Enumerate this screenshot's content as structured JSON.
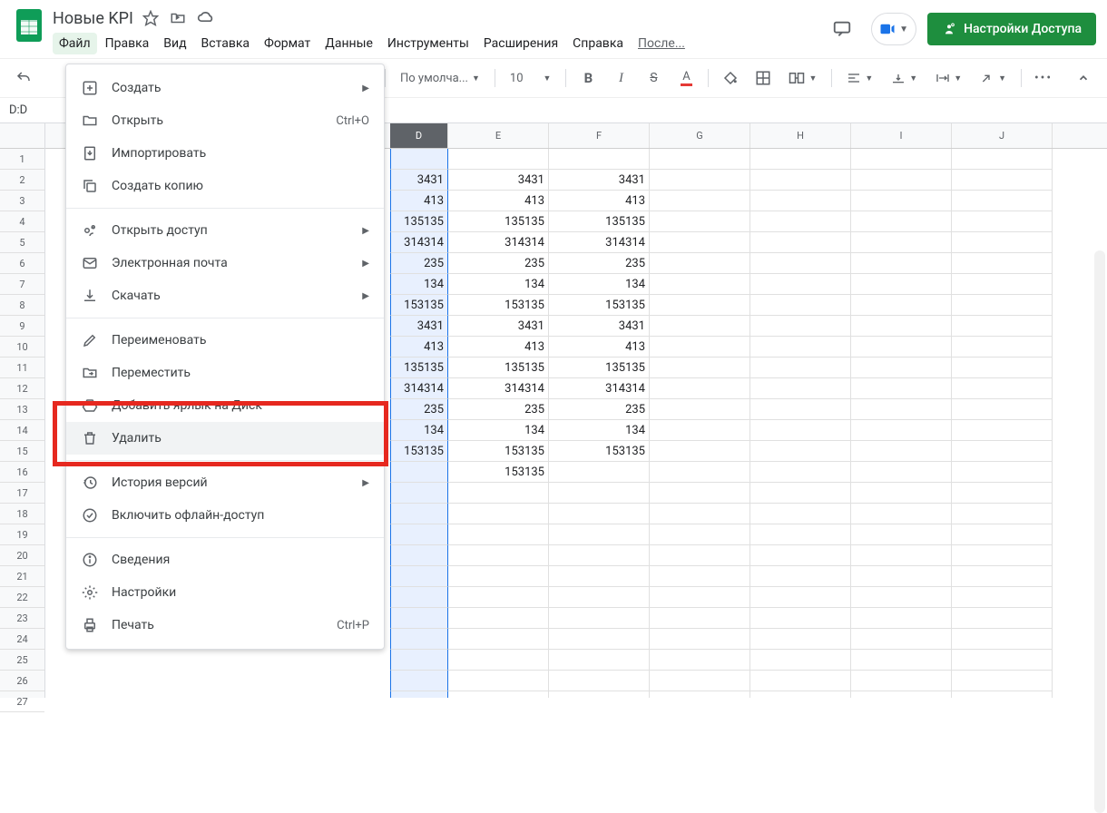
{
  "doc_title": "Новые KPI",
  "menus": [
    "Файл",
    "Правка",
    "Вид",
    "Вставка",
    "Формат",
    "Данные",
    "Инструменты",
    "Расширения",
    "Справка",
    "После..."
  ],
  "share_label": "Настройки Доступа",
  "toolbar": {
    "font_label": "По умолча...",
    "font_size": "10"
  },
  "namebox": "D:D",
  "col_headers": [
    "D",
    "E",
    "F",
    "G",
    "H",
    "I",
    "J"
  ],
  "row_count": 27,
  "data_rows": [
    [
      "",
      "",
      "",
      "",
      "",
      "",
      ""
    ],
    [
      "3431",
      "3431",
      "3431",
      "",
      "",
      "",
      ""
    ],
    [
      "413",
      "413",
      "413",
      "",
      "",
      "",
      ""
    ],
    [
      "135135",
      "135135",
      "135135",
      "",
      "",
      "",
      ""
    ],
    [
      "314314",
      "314314",
      "314314",
      "",
      "",
      "",
      ""
    ],
    [
      "235",
      "235",
      "235",
      "",
      "",
      "",
      ""
    ],
    [
      "134",
      "134",
      "134",
      "",
      "",
      "",
      ""
    ],
    [
      "153135",
      "153135",
      "153135",
      "",
      "",
      "",
      ""
    ],
    [
      "3431",
      "3431",
      "3431",
      "",
      "",
      "",
      ""
    ],
    [
      "413",
      "413",
      "413",
      "",
      "",
      "",
      ""
    ],
    [
      "135135",
      "135135",
      "135135",
      "",
      "",
      "",
      ""
    ],
    [
      "314314",
      "314314",
      "314314",
      "",
      "",
      "",
      ""
    ],
    [
      "235",
      "235",
      "235",
      "",
      "",
      "",
      ""
    ],
    [
      "134",
      "134",
      "134",
      "",
      "",
      "",
      ""
    ],
    [
      "153135",
      "153135",
      "153135",
      "",
      "",
      "",
      ""
    ],
    [
      "",
      "153135",
      "",
      "",
      "",
      "",
      ""
    ],
    [
      "",
      "",
      "",
      "",
      "",
      "",
      ""
    ],
    [
      "",
      "",
      "",
      "",
      "",
      "",
      ""
    ],
    [
      "",
      "",
      "",
      "",
      "",
      "",
      ""
    ],
    [
      "",
      "",
      "",
      "",
      "",
      "",
      ""
    ],
    [
      "",
      "",
      "",
      "",
      "",
      "",
      ""
    ],
    [
      "",
      "",
      "",
      "",
      "",
      "",
      ""
    ],
    [
      "",
      "",
      "",
      "",
      "",
      "",
      ""
    ],
    [
      "",
      "",
      "",
      "",
      "",
      "",
      ""
    ],
    [
      "",
      "",
      "",
      "",
      "",
      "",
      ""
    ],
    [
      "",
      "",
      "",
      "",
      "",
      "",
      ""
    ],
    [
      "",
      "",
      "",
      "",
      "",
      "",
      ""
    ]
  ],
  "dropdown": {
    "groups": [
      [
        {
          "icon": "plus-box",
          "label": "Создать",
          "arrow": true
        },
        {
          "icon": "folder",
          "label": "Открыть",
          "shortcut": "Ctrl+O"
        },
        {
          "icon": "import",
          "label": "Импортировать"
        },
        {
          "icon": "copy",
          "label": "Создать копию"
        }
      ],
      [
        {
          "icon": "share",
          "label": "Открыть доступ",
          "arrow": true
        },
        {
          "icon": "mail",
          "label": "Электронная почта",
          "arrow": true
        },
        {
          "icon": "download",
          "label": "Скачать",
          "arrow": true
        }
      ],
      [
        {
          "icon": "rename",
          "label": "Переименовать"
        },
        {
          "icon": "move",
          "label": "Переместить"
        },
        {
          "icon": "drive",
          "label": "Добавить ярлык на Диск"
        },
        {
          "icon": "trash",
          "label": "Удалить",
          "hovered": true
        }
      ],
      [
        {
          "icon": "history",
          "label": "История версий",
          "arrow": true
        },
        {
          "icon": "offline",
          "label": "Включить офлайн-доступ"
        }
      ],
      [
        {
          "icon": "info",
          "label": "Сведения"
        },
        {
          "icon": "gear",
          "label": "Настройки"
        },
        {
          "icon": "print",
          "label": "Печать",
          "shortcut": "Ctrl+P"
        }
      ]
    ]
  }
}
